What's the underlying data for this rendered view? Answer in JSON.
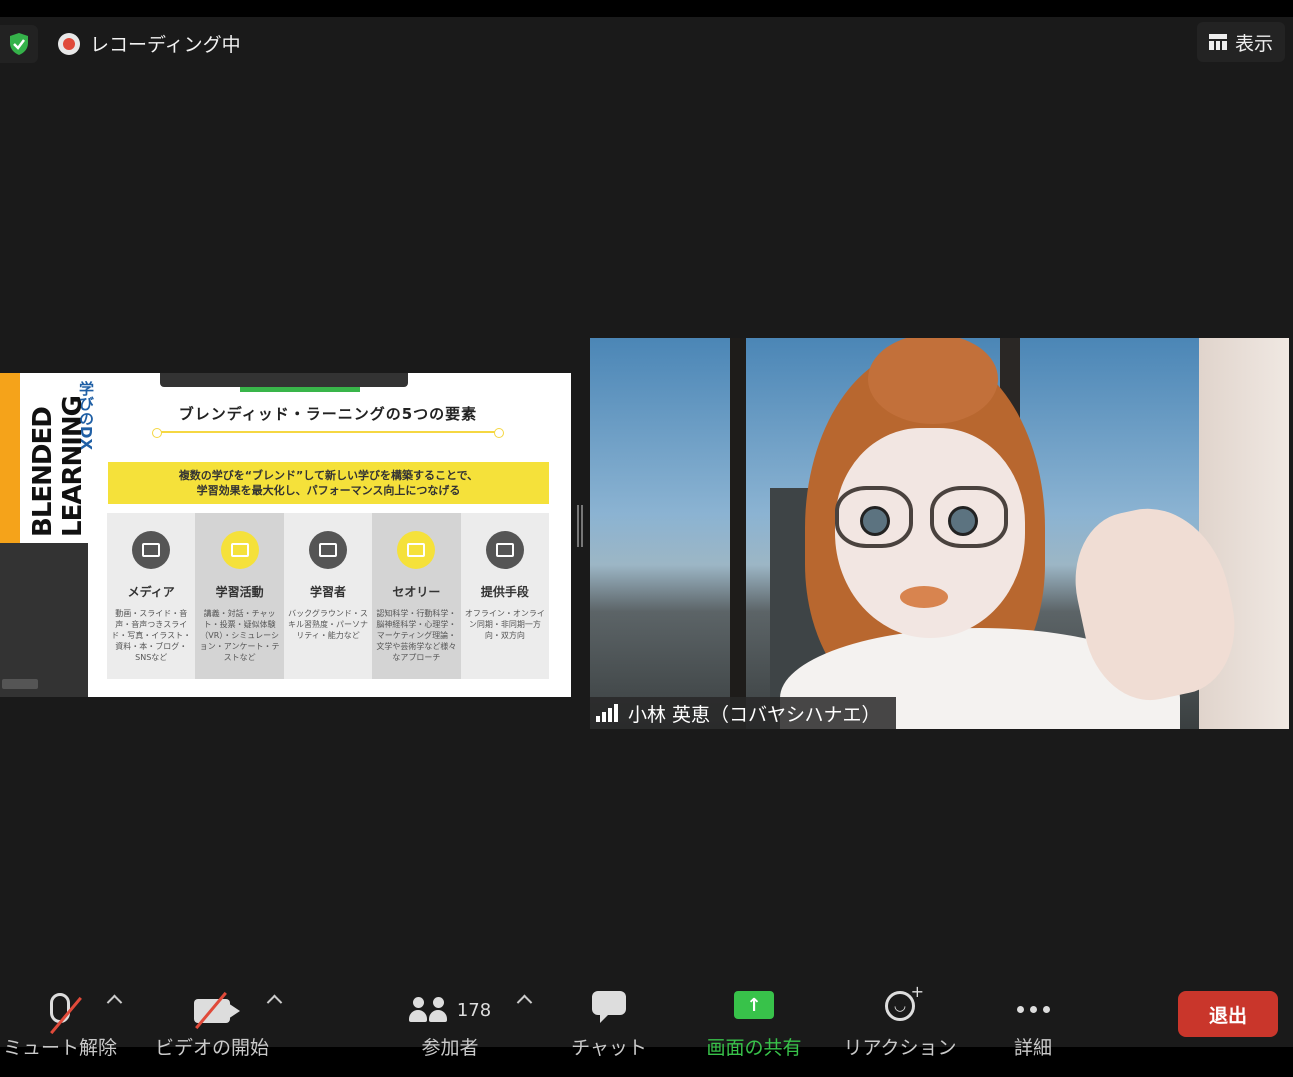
{
  "topbar": {
    "recording_label": "レコーディング中",
    "view_label": "表示"
  },
  "slide": {
    "book_title": "BLENDED LEARNING",
    "book_subtitle": "学びのDX",
    "title": "ブレンディッド・ラーニングの5つの要素",
    "banner_line1": "複数の学びを“ブレンド”して新しい学びを構築することで、",
    "banner_line2": "学習効果を最大化し、パフォーマンス向上につなげる",
    "columns": [
      {
        "heading": "メディア",
        "text": "動画・スライド・音声・音声つきスライド・写真・イラスト・資料・本・ブログ・SNSなど"
      },
      {
        "heading": "学習活動",
        "text": "講義・対話・チャット・投票・疑似体験（VR）・シミュレーション・アンケート・テストなど"
      },
      {
        "heading": "学習者",
        "text": "バックグラウンド・スキル習熟度・パーソナリティ・能力など"
      },
      {
        "heading": "セオリー",
        "text": "認知科学・行動科学・脳神経科学・心理学・マーケティング理論・文学や芸術学など様々なアプローチ"
      },
      {
        "heading": "提供手段",
        "text": "オフライン・オンライン同期・非同期一方向・双方向"
      }
    ]
  },
  "video": {
    "participant_name": "小林 英恵（コバヤシハナエ）"
  },
  "toolbar": {
    "unmute_label": "ミュート解除",
    "start_video_label": "ビデオの開始",
    "participants_label": "参加者",
    "participants_count": "178",
    "chat_label": "チャット",
    "share_label": "画面の共有",
    "reaction_label": "リアクション",
    "more_label": "詳細",
    "leave_label": "退出"
  },
  "colors": {
    "share_green": "#38c24a",
    "leave_red": "#c9362b",
    "slide_yellow": "#f5e13a"
  }
}
